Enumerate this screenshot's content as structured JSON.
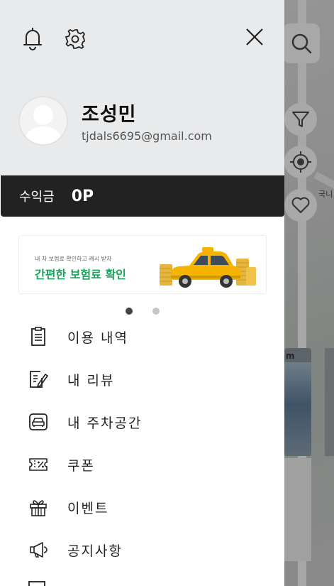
{
  "header": {
    "bell_icon": "bell-icon",
    "gear_icon": "gear-icon",
    "close_icon": "close-icon"
  },
  "profile": {
    "name": "조성민",
    "email": "tjdals6695@gmail.com"
  },
  "earnings": {
    "label": "수익금",
    "value": "0P"
  },
  "banner": {
    "small_text": "내 차 보험료 확인하고 캐시 받자",
    "big_text": "간편한 보험료 확인",
    "dots_total": 2,
    "dots_active": 1
  },
  "menu": {
    "items": [
      {
        "label": "이용 내역",
        "icon": "receipt-icon"
      },
      {
        "label": "내 리뷰",
        "icon": "review-icon"
      },
      {
        "label": "내 주차공간",
        "icon": "car-icon"
      },
      {
        "label": "쿠폰",
        "icon": "coupon-icon"
      },
      {
        "label": "이벤트",
        "icon": "gift-icon"
      },
      {
        "label": "공지사항",
        "icon": "megaphone-icon"
      }
    ]
  },
  "map": {
    "label": "국니",
    "card_text": "m"
  },
  "colors": {
    "drawer_header_bg": "#e9eaec",
    "earnings_bg": "#222222",
    "banner_accent": "#1aa45a",
    "taxi_yellow": "#f6b400"
  }
}
